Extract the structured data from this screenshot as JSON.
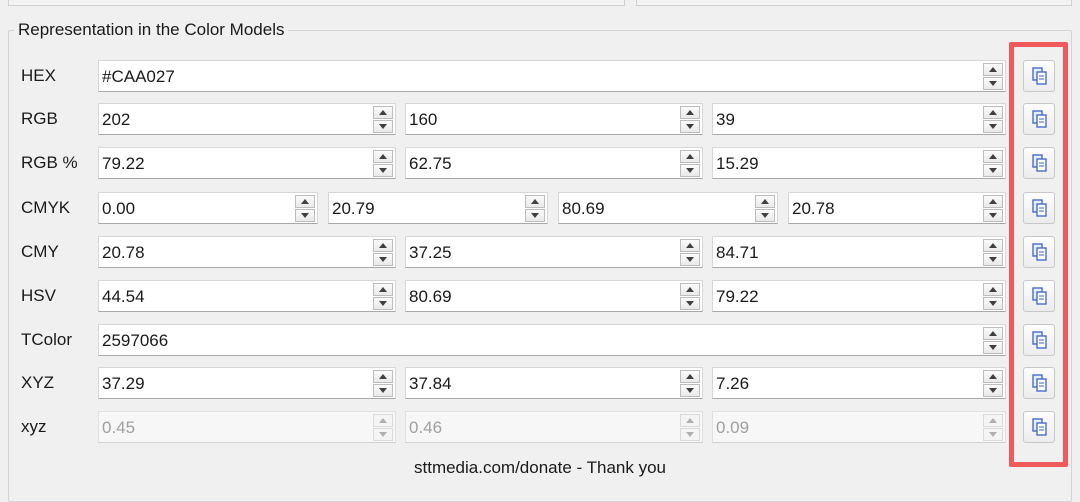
{
  "group_title": "Representation in the Color Models",
  "footer_text": "sttmedia.com/donate - Thank you",
  "highlight_color": "#f05a5a",
  "rows": [
    {
      "label": "HEX",
      "values": [
        "#CAA027"
      ]
    },
    {
      "label": "RGB",
      "values": [
        "202",
        "160",
        "39"
      ]
    },
    {
      "label": "RGB %",
      "values": [
        "79.22",
        "62.75",
        "15.29"
      ]
    },
    {
      "label": "CMYK",
      "values": [
        "0.00",
        "20.79",
        "80.69",
        "20.78"
      ]
    },
    {
      "label": "CMY",
      "values": [
        "20.78",
        "37.25",
        "84.71"
      ]
    },
    {
      "label": "HSV",
      "values": [
        "44.54",
        "80.69",
        "79.22"
      ]
    },
    {
      "label": "TColor",
      "values": [
        "2597066"
      ]
    },
    {
      "label": "XYZ",
      "values": [
        "37.29",
        "37.84",
        "7.26"
      ]
    },
    {
      "label": "xyz",
      "values": [
        "0.45",
        "0.46",
        "0.09"
      ],
      "disabled": true
    }
  ],
  "copy_icon": "copy-icon"
}
